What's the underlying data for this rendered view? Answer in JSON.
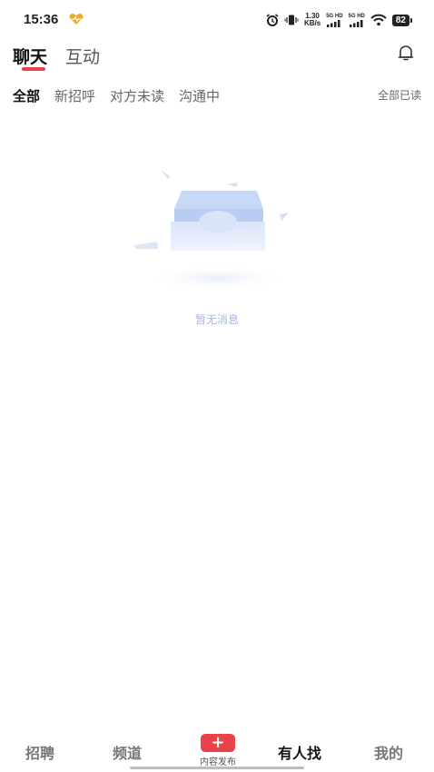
{
  "status_bar": {
    "time": "15:36",
    "net_speed_value": "1.30",
    "net_speed_unit": "KB/s",
    "sim1_label": "5G HD",
    "sim2_label": "5G HD",
    "battery": "82",
    "icons": [
      "heart-icon",
      "alarm-icon",
      "vibrate-icon",
      "signal-icon",
      "wifi-icon",
      "battery-icon"
    ]
  },
  "header": {
    "tabs": [
      {
        "label": "聊天",
        "active": true
      },
      {
        "label": "互动",
        "active": false
      }
    ],
    "accent_color": "#e8424a"
  },
  "filters": {
    "items": [
      {
        "label": "全部",
        "active": true
      },
      {
        "label": "新招呼",
        "active": false
      },
      {
        "label": "对方未读",
        "active": false
      },
      {
        "label": "沟通中",
        "active": false
      }
    ],
    "mark_all_read": "全部已读"
  },
  "empty_state": {
    "message": "暂无消息",
    "icon": "empty-inbox-icon"
  },
  "bottom_nav": {
    "items": [
      {
        "label": "招聘",
        "active": false
      },
      {
        "label": "频道",
        "active": false
      },
      {
        "label": "有人找",
        "active": true
      },
      {
        "label": "我的",
        "active": false
      }
    ],
    "publish": {
      "symbol": "+",
      "label": "内容发布"
    }
  }
}
